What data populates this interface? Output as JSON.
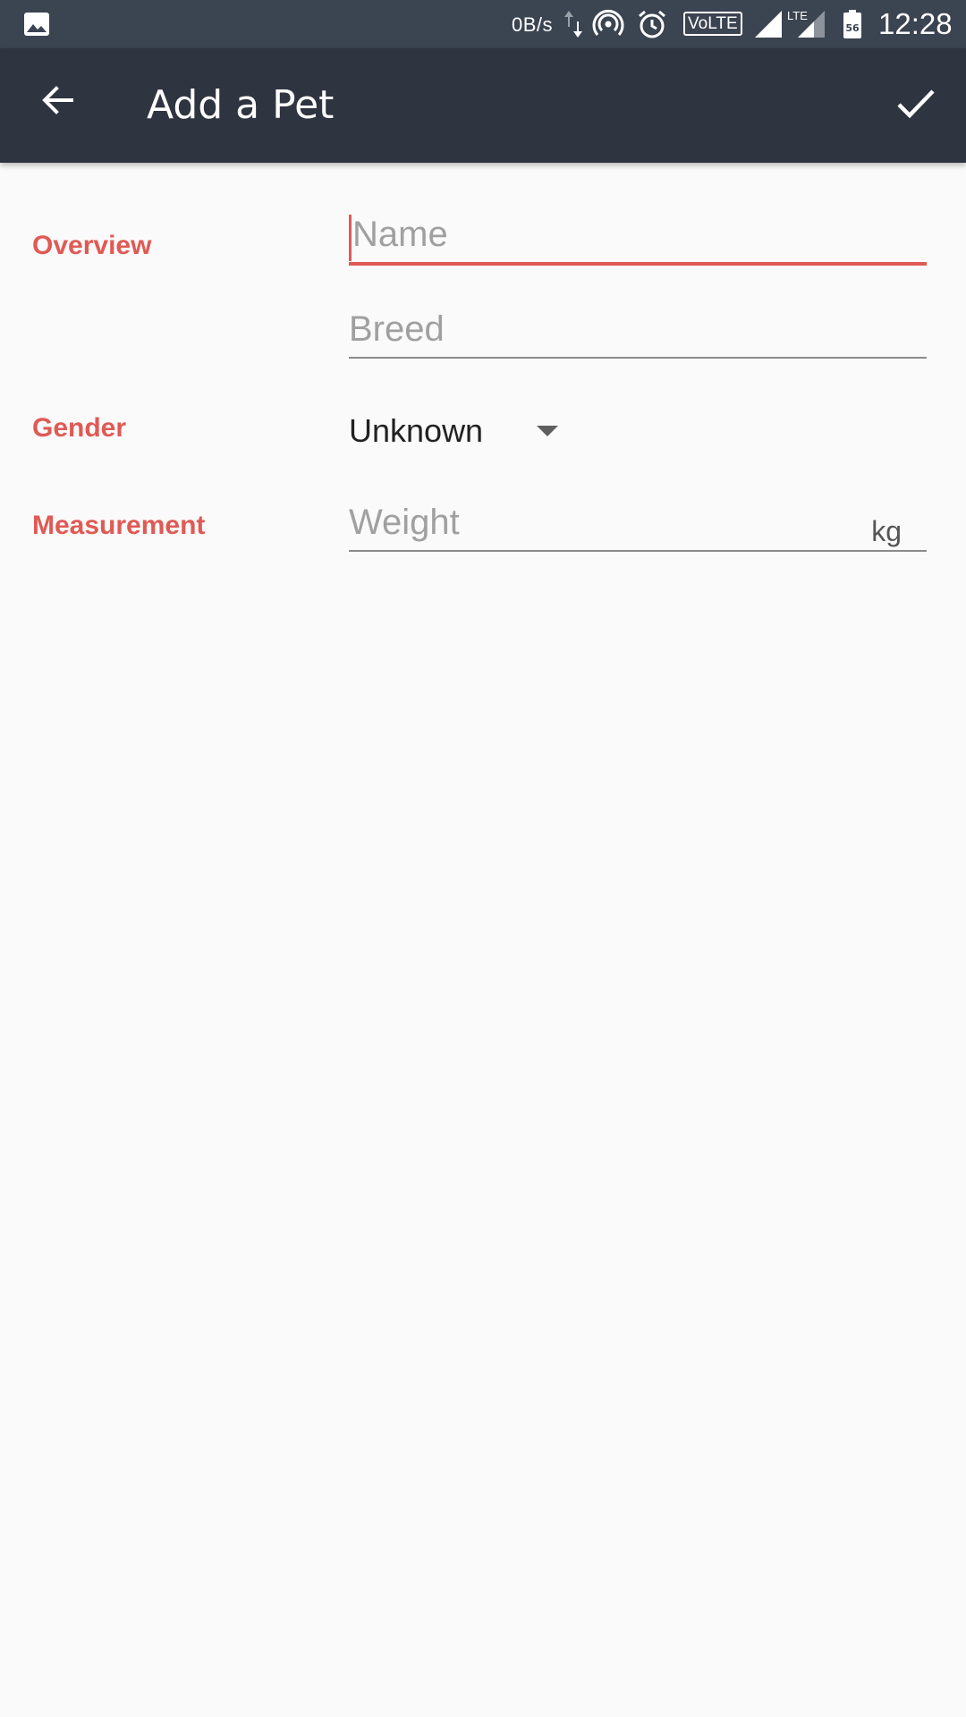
{
  "status_bar": {
    "network_speed": "0B/s",
    "volte": "VoLTE",
    "lte": "LTE",
    "battery_level": "56",
    "time": "12:28"
  },
  "app_bar": {
    "title": "Add a Pet"
  },
  "form": {
    "overview_label": "Overview",
    "name_placeholder": "Name",
    "breed_placeholder": "Breed",
    "gender_label": "Gender",
    "gender_value": "Unknown",
    "measurement_label": "Measurement",
    "weight_placeholder": "Weight",
    "weight_unit": "kg"
  },
  "colors": {
    "accent": "#e05a55",
    "app_bar": "#2e3440",
    "status_bar": "#3b4451",
    "background": "#fafafa"
  }
}
